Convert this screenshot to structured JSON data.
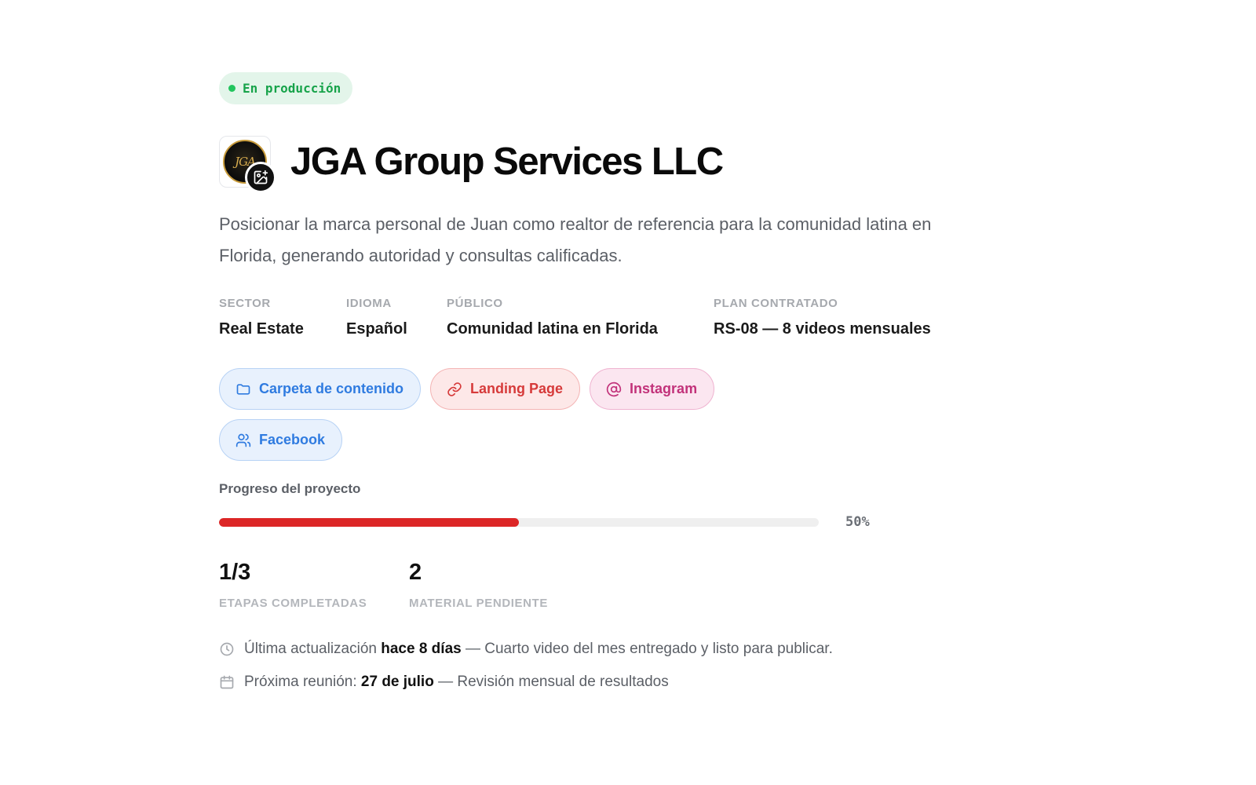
{
  "status": {
    "label": "En producción"
  },
  "client": {
    "logo_text": "JGA",
    "name": "JGA Group Services LLC",
    "description": "Posicionar la marca personal de Juan como realtor de referencia para la comunidad latina en Florida, generando autoridad y consultas calificadas."
  },
  "meta": [
    {
      "label": "SECTOR",
      "value": "Real Estate"
    },
    {
      "label": "IDIOMA",
      "value": "Español"
    },
    {
      "label": "PÚBLICO",
      "value": "Comunidad latina en Florida"
    },
    {
      "label": "PLAN CONTRATADO",
      "value": "RS-08 — 8 videos mensuales"
    }
  ],
  "links": [
    {
      "label": "Carpeta de contenido",
      "icon": "folder-icon",
      "color": "#2f7be0"
    },
    {
      "label": "Landing Page",
      "icon": "link-icon",
      "color": "#d63a3a"
    },
    {
      "label": "Instagram",
      "icon": "at-icon",
      "color": "#c2327a"
    },
    {
      "label": "Facebook",
      "icon": "users-icon",
      "color": "#2f7be0"
    }
  ],
  "progress": {
    "label": "Progreso del proyecto",
    "percent_text": "50%",
    "value": 0.5,
    "color": "#dc2626"
  },
  "stats": [
    {
      "value": "1/3",
      "label": "ETAPAS COMPLETADAS"
    },
    {
      "value": "2",
      "label": "MATERIAL PENDIENTE"
    }
  ],
  "updates": {
    "last_update_prefix": "Última actualización",
    "last_update_time": "hace 8 días",
    "last_update_note": "— Cuarto video del mes entregado y listo para publicar.",
    "next_meeting_prefix": "Próxima reunión:",
    "next_meeting_date": "27 de julio",
    "next_meeting_note": "— Revisión mensual de resultados"
  },
  "colors": {
    "accent_green": "#22c55e",
    "accent_red": "#dc2626",
    "accent_blue": "#2f7be0"
  }
}
